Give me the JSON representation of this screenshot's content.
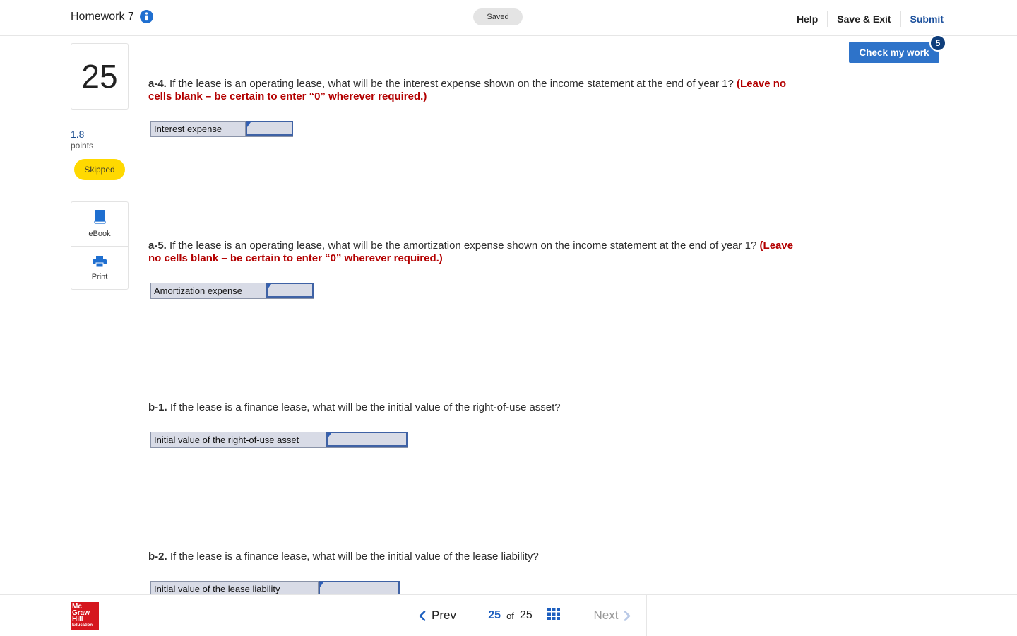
{
  "header": {
    "title": "Homework 7",
    "saved_label": "Saved",
    "nav": {
      "help": "Help",
      "save_exit": "Save & Exit",
      "submit": "Submit"
    }
  },
  "sidebar": {
    "question_number": "25",
    "points_value": "1.8",
    "points_label": "points",
    "status_badge": "Skipped",
    "tools": {
      "ebook": "eBook",
      "print": "Print"
    }
  },
  "check_work": {
    "label": "Check my work",
    "remaining": "5"
  },
  "questions": [
    {
      "label": "a-4.",
      "text": " If the lease is an operating lease, what will be the interest expense shown on the income statement at the end of year 1? ",
      "note": "(Leave no cells blank – be certain to enter “0” wherever required.)",
      "field_label": "Interest expense",
      "field_value": ""
    },
    {
      "label": "a-5.",
      "text": " If the lease is an operating lease, what will be the amortization expense shown on the income statement at the end of year 1? ",
      "note": "(Leave no cells blank – be certain to enter “0” wherever required.)",
      "field_label": "Amortization expense",
      "field_value": ""
    },
    {
      "label": "b-1.",
      "text": " If the lease is a finance lease, what will be the initial value of the right-of-use asset?",
      "note": "",
      "field_label": "Initial value of the right-of-use asset",
      "field_value": ""
    },
    {
      "label": "b-2.",
      "text": " If the lease is a finance lease, what will be the initial value of the lease liability?",
      "note": "",
      "field_label": "Initial value of the lease liability",
      "field_value": ""
    }
  ],
  "footer": {
    "logo": {
      "line1": "Mc",
      "line2": "Graw",
      "line3": "Hill",
      "line4": "Education"
    },
    "prev_label": "Prev",
    "current_page": "25",
    "of_label": "of",
    "total_pages": "25",
    "next_label": "Next"
  },
  "colors": {
    "accent_blue": "#2e73c9",
    "note_red": "#b30000",
    "skipped_yellow": "#ffd900",
    "logo_red": "#d5161d"
  }
}
